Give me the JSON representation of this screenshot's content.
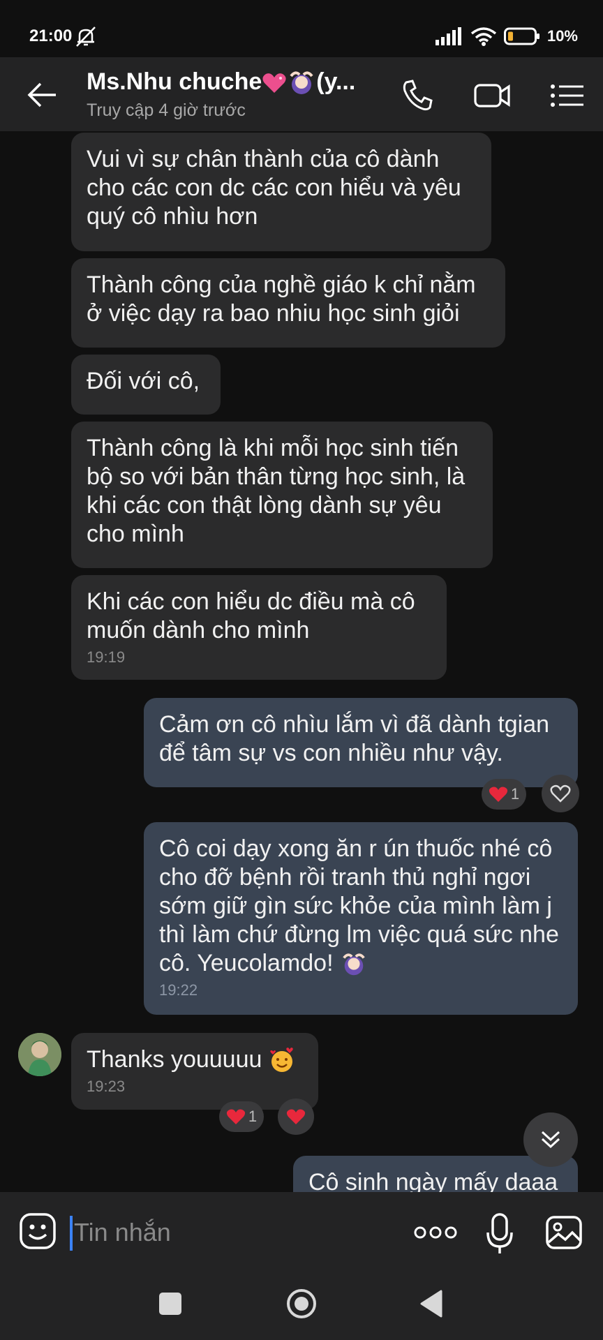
{
  "status_bar": {
    "time": "21:00",
    "battery": "10%"
  },
  "header": {
    "contact_name": "Ms.Nhu chuche",
    "name_suffix": "(y...",
    "last_seen": "Truy cập 4 giờ trước"
  },
  "messages": [
    {
      "text": "Vui vì sự chân thành của cô dành cho các con dc các con hiểu và yêu quý cô nhìu hơn"
    },
    {
      "text": "Thành công của nghề giáo k chỉ nằm ở việc dạy ra bao nhiu học sinh giỏi"
    },
    {
      "text": "Đối với cô,"
    },
    {
      "text": "Thành công là khi mỗi học sinh tiến bộ so với bản thân từng học sinh, là khi các con thật lòng dành sự yêu cho mình"
    },
    {
      "text": "Khi các con hiểu dc điều mà cô muốn dành cho mình",
      "time": "19:19"
    },
    {
      "text": "Cảm ơn cô nhìu lắm vì đã dành tgian để tâm sự vs con nhiều như vậy.",
      "reaction_count": "1"
    },
    {
      "text": "Cô coi dạy xong ăn r ún thuốc nhé cô cho đỡ bệnh rồi tranh thủ nghỉ ngơi sớm giữ gìn sức khỏe của mình làm j thì làm chứ đừng lm việc quá sức nhe cô. Yeucolamdo!",
      "time": "19:22"
    },
    {
      "text": "Thanks youuuuu",
      "time": "19:23",
      "reaction_count": "1"
    },
    {
      "text": "Cô sinh ngày mấy daaa"
    }
  ],
  "input": {
    "placeholder": "Tin nhắn"
  },
  "icons": {
    "back": "arrow-left-icon",
    "call": "phone-icon",
    "video": "video-camera-icon",
    "menu": "list-menu-icon",
    "sticker": "smiley-sticker-icon",
    "more": "more-dots-icon",
    "mic": "microphone-icon",
    "image": "image-icon",
    "scroll": "double-chevron-down-icon",
    "heart": "heart-icon"
  },
  "colors": {
    "background": "#101010",
    "header": "#232324",
    "incoming_bubble": "#2b2b2c",
    "outgoing_bubble": "#3a4453",
    "heart": "#e8283c",
    "cursor": "#3b82f6"
  }
}
